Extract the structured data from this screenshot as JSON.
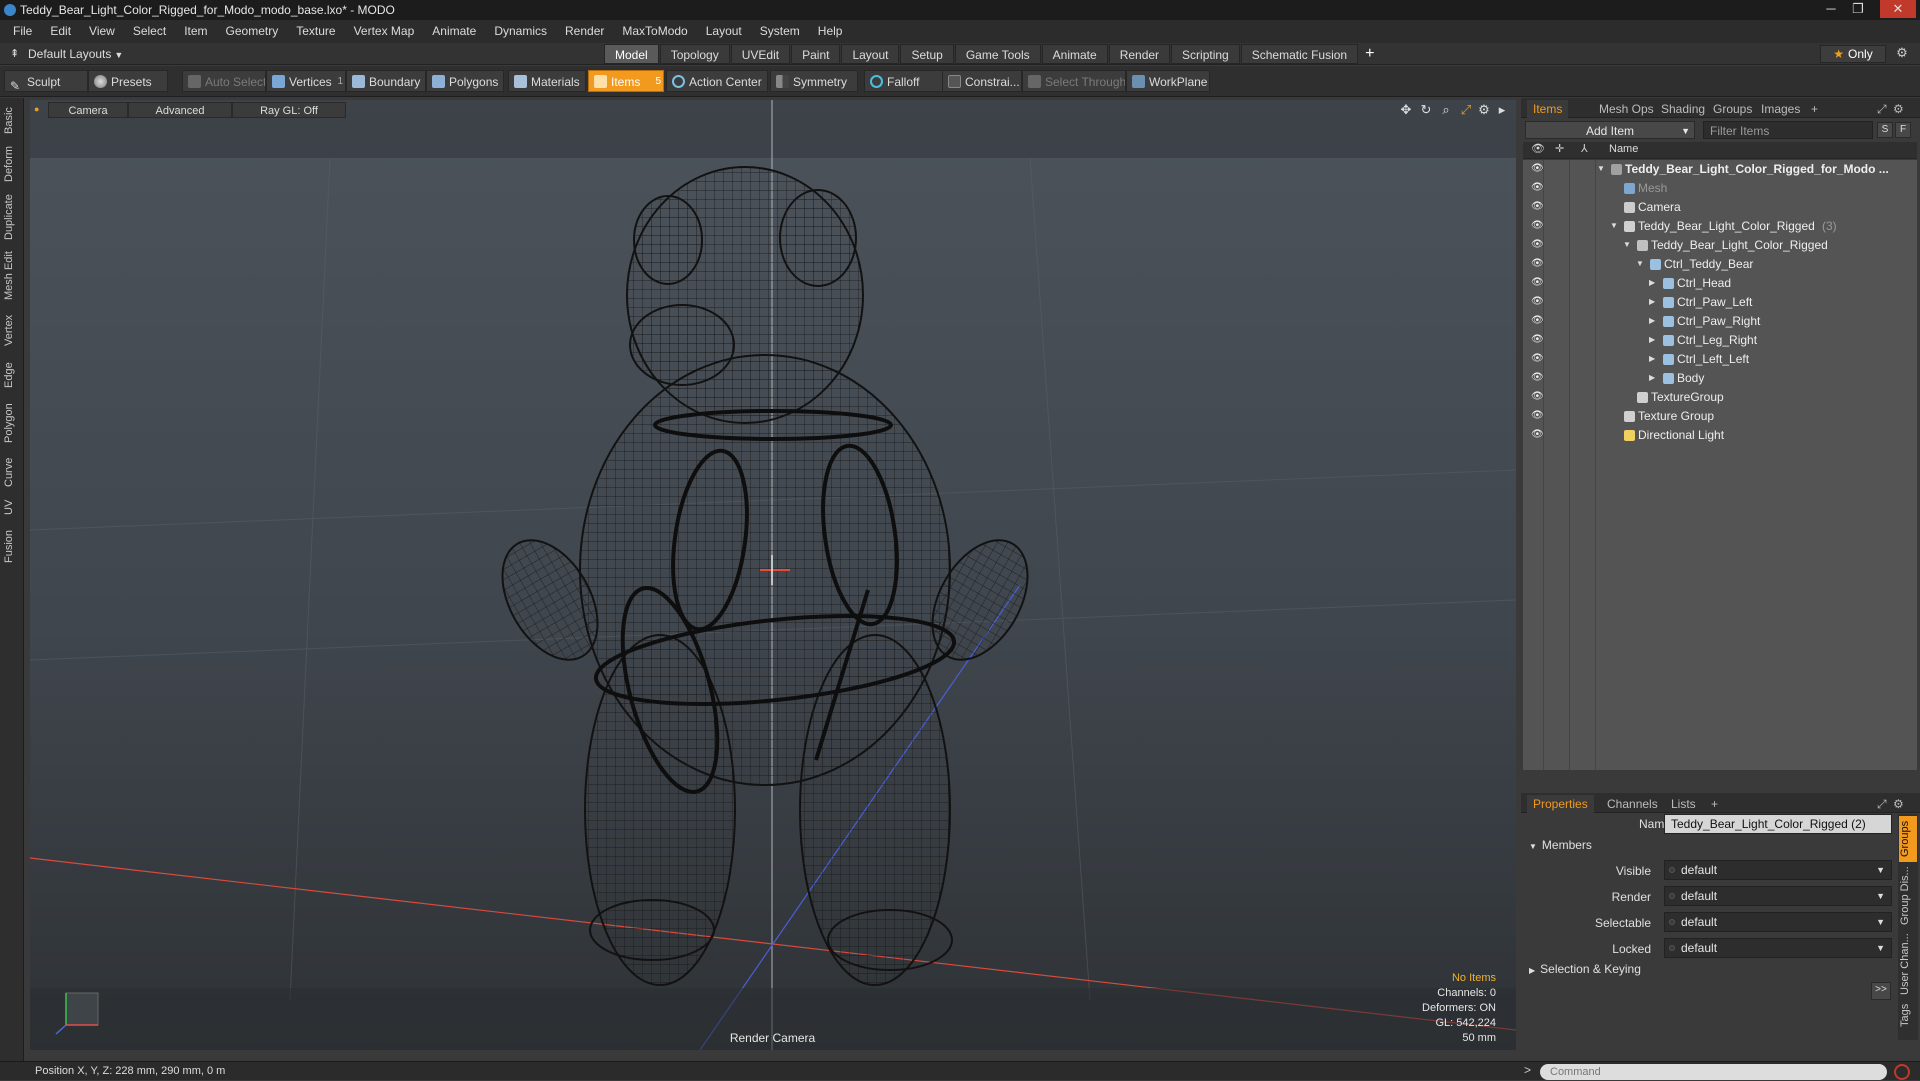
{
  "window": {
    "title": "Teddy_Bear_Light_Color_Rigged_for_Modo_modo_base.lxo* - MODO",
    "controls": [
      "─",
      "❐",
      "✕"
    ]
  },
  "menu": [
    "File",
    "Edit",
    "View",
    "Select",
    "Item",
    "Geometry",
    "Texture",
    "Vertex Map",
    "Animate",
    "Dynamics",
    "Render",
    "MaxToModo",
    "Layout",
    "System",
    "Help"
  ],
  "layouts": {
    "label": "Default Layouts"
  },
  "mode_tabs": [
    {
      "label": "Model",
      "active": true
    },
    {
      "label": "Topology"
    },
    {
      "label": "UVEdit"
    },
    {
      "label": "Paint"
    },
    {
      "label": "Layout"
    },
    {
      "label": "Setup"
    },
    {
      "label": "Game Tools"
    },
    {
      "label": "Animate"
    },
    {
      "label": "Render"
    },
    {
      "label": "Scripting"
    },
    {
      "label": "Schematic Fusion"
    }
  ],
  "only_btn": "Only",
  "toolbar": {
    "sculpt": "Sculpt",
    "presets": "Presets",
    "auto_select": "Auto Select",
    "vertices": "Vertices",
    "vertices_count": "1",
    "boundary": "Boundary",
    "polygons": "Polygons",
    "materials": "Materials",
    "items": "Items",
    "items_count": "5",
    "action_center": "Action Center",
    "symmetry": "Symmetry",
    "falloff": "Falloff",
    "constraints": "Constrai...",
    "select_through": "Select Through",
    "workplane": "WorkPlane"
  },
  "left_tabs": [
    "Basic",
    "Deform",
    "Duplicate",
    "Mesh Edit",
    "Vertex",
    "Edge",
    "Polygon",
    "Curve",
    "UV",
    "Fusion"
  ],
  "viewport": {
    "camera_btn": "Camera",
    "advanced_btn": "Advanced",
    "raygl_btn": "Ray GL: Off",
    "info": {
      "no_items": "No Items",
      "channels": "Channels: 0",
      "deformers": "Deformers: ON",
      "gl": "GL: 542,224",
      "lens": "50 mm"
    },
    "render_camera": "Render Camera",
    "colors": {
      "bg_top": "#4a5058",
      "bg_bottom": "#2e3236",
      "wire": "#141414",
      "accent": "#f29a1e"
    }
  },
  "items_panel": {
    "tabs": [
      "Items",
      "Mesh Ops",
      "Shading",
      "Groups",
      "Images"
    ],
    "add_item": "Add Item",
    "filter_placeholder": "Filter Items",
    "s_btn": "S",
    "f_btn": "F",
    "name_col": "Name",
    "tree": [
      {
        "label": "Teddy_Bear_Light_Color_Rigged_for_Modo ...",
        "indent": 0,
        "arrow": "▼",
        "icon": "scene",
        "bold": true
      },
      {
        "label": "Mesh",
        "indent": 1,
        "arrow": "",
        "icon": "mesh",
        "dim": true
      },
      {
        "label": "Camera",
        "indent": 1,
        "arrow": "",
        "icon": "camera"
      },
      {
        "label": "Teddy_Bear_Light_Color_Rigged",
        "count": "(3)",
        "indent": 1,
        "arrow": "▼",
        "icon": "group"
      },
      {
        "label": "Teddy_Bear_Light_Color_Rigged",
        "indent": 2,
        "arrow": "▼",
        "icon": "locator"
      },
      {
        "label": "Ctrl_Teddy_Bear",
        "indent": 3,
        "arrow": "▼",
        "icon": "ctrl"
      },
      {
        "label": "Ctrl_Head",
        "indent": 4,
        "arrow": "▶",
        "icon": "ctrl"
      },
      {
        "label": "Ctrl_Paw_Left",
        "indent": 4,
        "arrow": "▶",
        "icon": "ctrl"
      },
      {
        "label": "Ctrl_Paw_Right",
        "indent": 4,
        "arrow": "▶",
        "icon": "ctrl"
      },
      {
        "label": "Ctrl_Leg_Right",
        "indent": 4,
        "arrow": "▶",
        "icon": "ctrl"
      },
      {
        "label": "Ctrl_Left_Left",
        "indent": 4,
        "arrow": "▶",
        "icon": "ctrl"
      },
      {
        "label": "Body",
        "indent": 4,
        "arrow": "▶",
        "icon": "ctrl"
      },
      {
        "label": "TextureGroup",
        "indent": 2,
        "arrow": "",
        "icon": "group"
      },
      {
        "label": "Texture Group",
        "indent": 1,
        "arrow": "",
        "icon": "group"
      },
      {
        "label": "Directional Light",
        "indent": 1,
        "arrow": "",
        "icon": "light"
      }
    ]
  },
  "properties_panel": {
    "tabs": [
      "Properties",
      "Channels",
      "Lists"
    ],
    "name_label": "Name",
    "name_value": "Teddy_Bear_Light_Color_Rigged (2)",
    "members": "Members",
    "fields": [
      {
        "label": "Visible",
        "value": "default"
      },
      {
        "label": "Render",
        "value": "default"
      },
      {
        "label": "Selectable",
        "value": "default"
      },
      {
        "label": "Locked",
        "value": "default"
      }
    ],
    "selection_keying": "Selection & Keying",
    "expand_btn": ">>",
    "side_tabs": [
      "Groups",
      "Group Dis...",
      "User Chan...",
      "Tags"
    ]
  },
  "status": {
    "position": "Position X, Y, Z:  228 mm, 290 mm, 0 m",
    "command_placeholder": "Command"
  }
}
